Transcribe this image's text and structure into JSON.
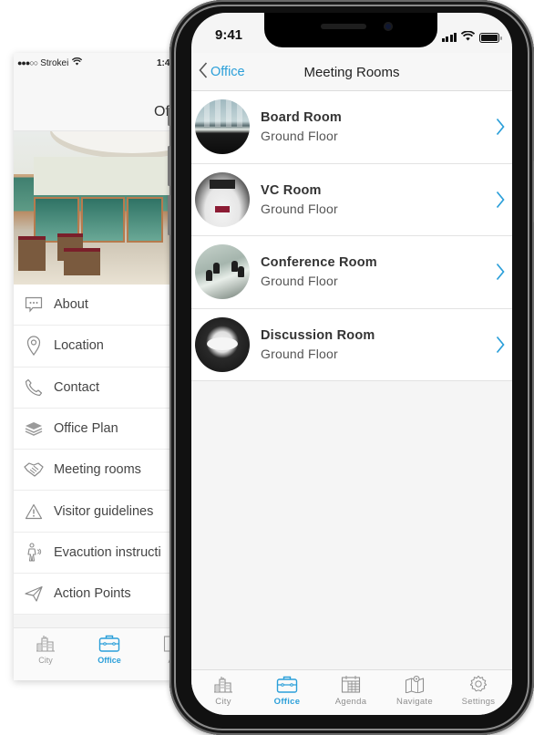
{
  "back_phone": {
    "status": {
      "carrier": "Strokei",
      "signal_dots": "●●●○○",
      "time": "1:4"
    },
    "title": "Of",
    "menu_items": [
      {
        "label": "About",
        "icon": "speech-bubble-icon"
      },
      {
        "label": "Location",
        "icon": "location-pin-icon"
      },
      {
        "label": "Contact",
        "icon": "phone-icon"
      },
      {
        "label": "Office Plan",
        "icon": "layers-icon"
      },
      {
        "label": "Meeting rooms",
        "icon": "handshake-icon"
      },
      {
        "label": "Visitor guidelines",
        "icon": "warning-icon"
      },
      {
        "label": "Evacution instructi",
        "icon": "walking-person-icon"
      },
      {
        "label": "Action Points",
        "icon": "paper-plane-icon"
      }
    ],
    "tabs": [
      {
        "label": "City",
        "icon": "city-icon",
        "active": false
      },
      {
        "label": "Office",
        "icon": "briefcase-icon",
        "active": true
      },
      {
        "label": "Ag",
        "icon": "calendar-icon",
        "active": false
      }
    ]
  },
  "front_phone": {
    "status": {
      "time": "9:41",
      "battery_level": 1.0
    },
    "nav": {
      "back_label": "Office",
      "title": "Meeting Rooms"
    },
    "rooms": [
      {
        "name": "Board Room",
        "floor": "Ground Floor"
      },
      {
        "name": "VC Room",
        "floor": "Ground Floor"
      },
      {
        "name": "Conference Room",
        "floor": "Ground Floor"
      },
      {
        "name": "Discussion Room",
        "floor": "Ground Floor"
      }
    ],
    "tabs": [
      {
        "label": "City",
        "icon": "city-icon",
        "active": false
      },
      {
        "label": "Office",
        "icon": "briefcase-icon",
        "active": true
      },
      {
        "label": "Agenda",
        "icon": "calendar-icon",
        "active": false
      },
      {
        "label": "Navigate",
        "icon": "map-icon",
        "active": false
      },
      {
        "label": "Settings",
        "icon": "gear-icon",
        "active": false
      }
    ]
  },
  "colors": {
    "accent": "#2b9fd9",
    "inactive_tab": "#8f8f8f",
    "primary_text": "#333333"
  }
}
